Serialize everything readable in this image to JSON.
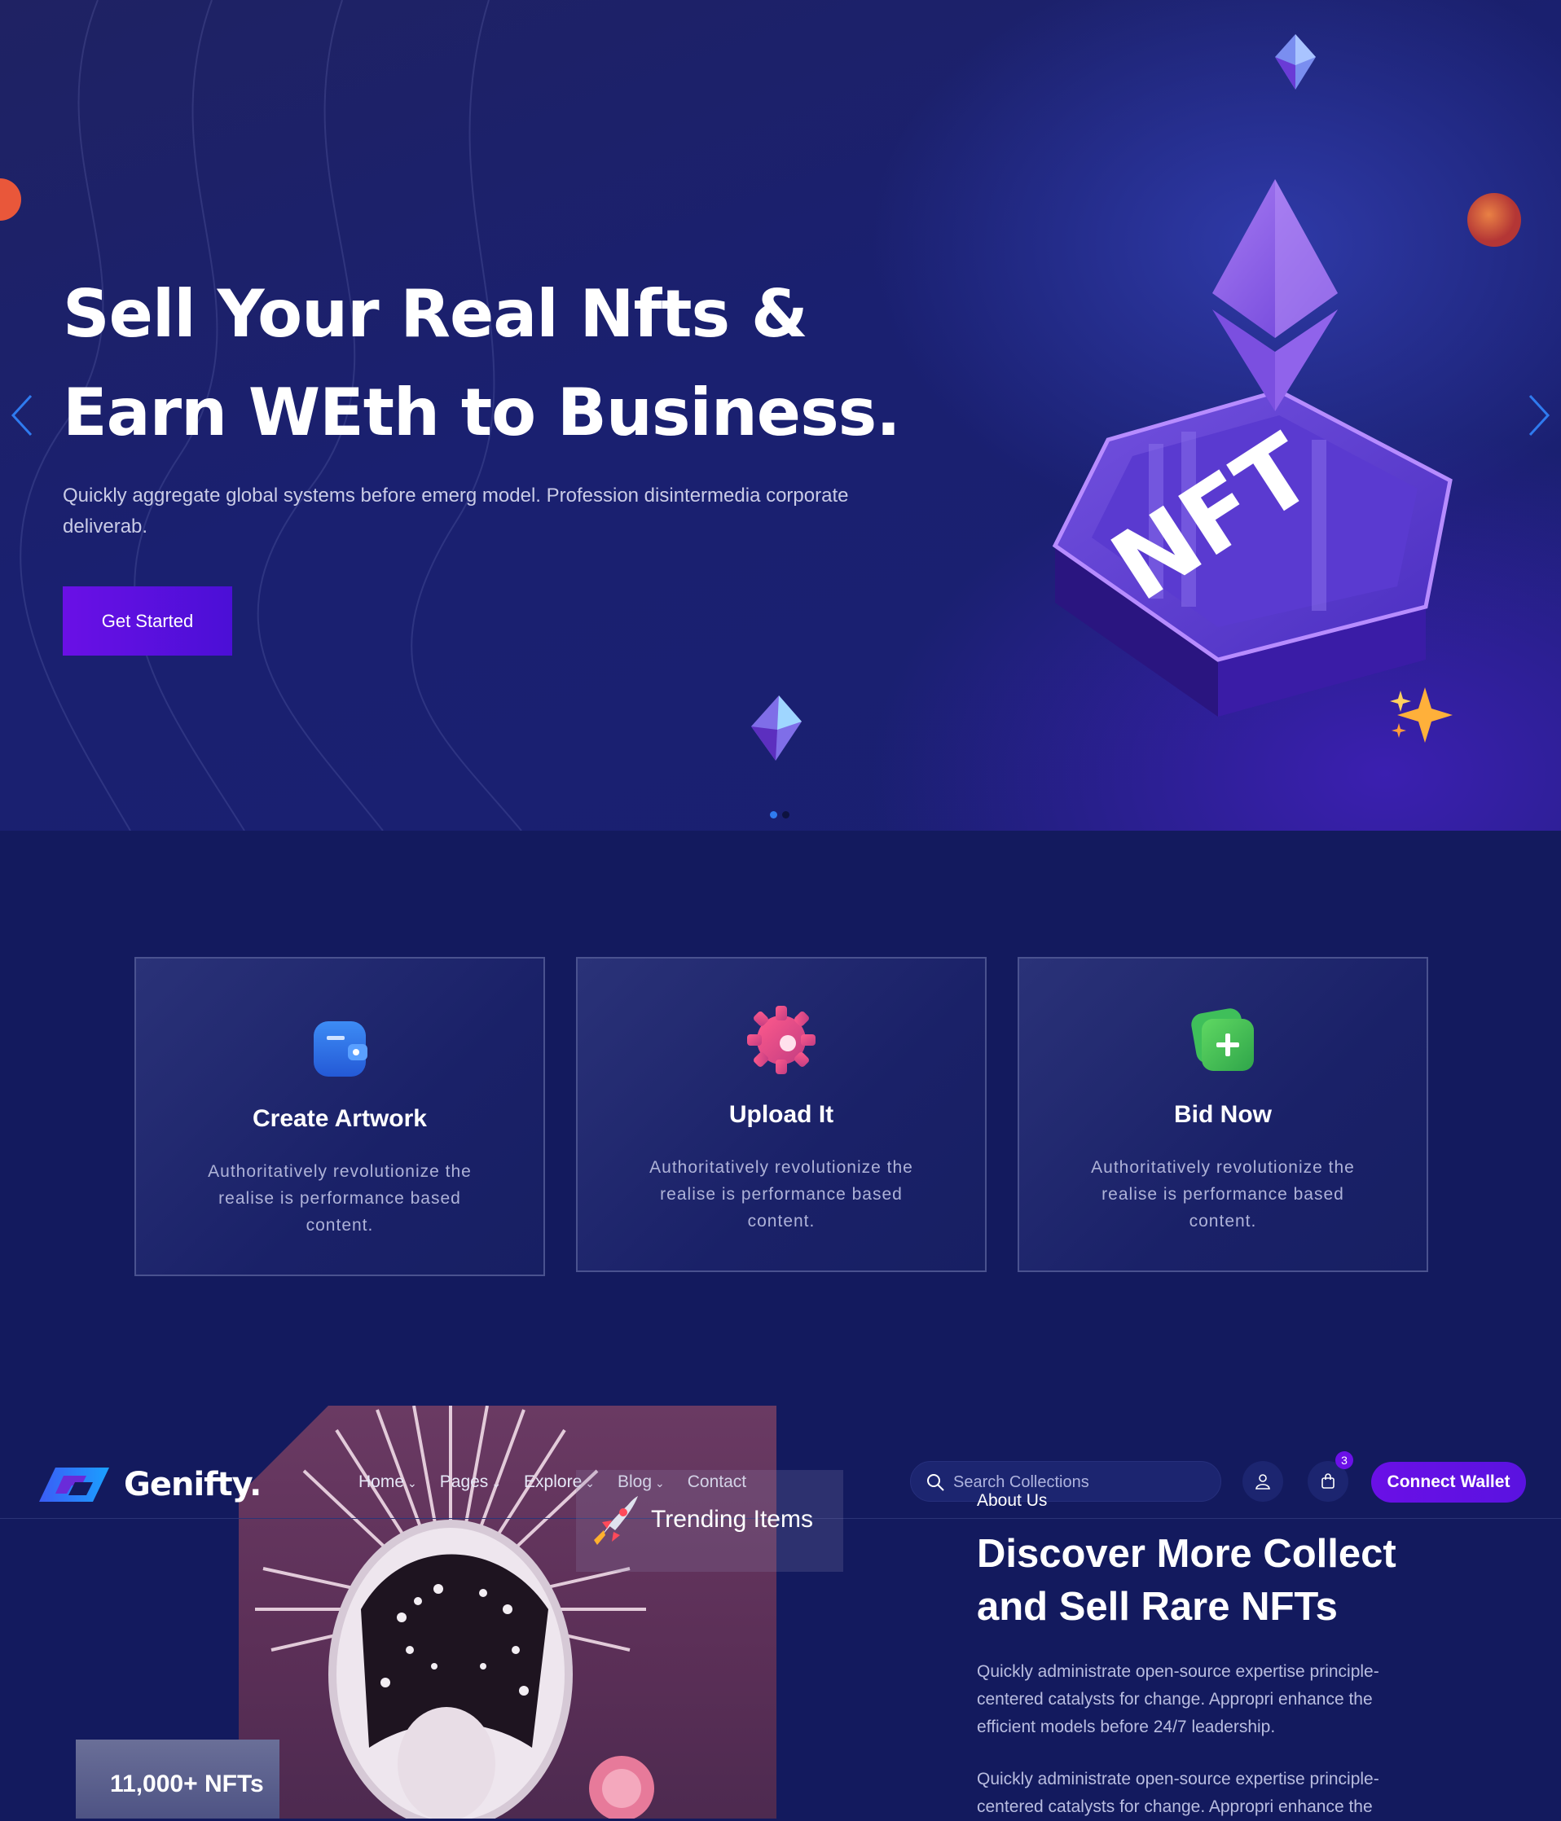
{
  "hero": {
    "title_line1": "Sell Your Real Nfts &",
    "title_line2": "Earn WEth to Business.",
    "subtitle": "Quickly aggregate global systems before emerg model. Profession disintermedia corporate deliverab.",
    "cta_label": "Get Started",
    "art_label": "NFT",
    "slides_total": 2,
    "active_slide": 1
  },
  "features": [
    {
      "icon": "wallet-icon",
      "title": "Create Artwork",
      "text": "Authoritatively revolutionize the realise is performance based content."
    },
    {
      "icon": "gear-icon",
      "title": "Upload It",
      "text": "Authoritatively revolutionize the realise is performance based content."
    },
    {
      "icon": "plus-icon",
      "title": "Bid Now",
      "text": "Authoritatively revolutionize the realise is performance based content."
    }
  ],
  "header": {
    "brand": "Genifty.",
    "menu": [
      {
        "label": "Home",
        "has_dropdown": true
      },
      {
        "label": "Pages",
        "has_dropdown": true
      },
      {
        "label": "Explore",
        "has_dropdown": true
      },
      {
        "label": "Blog",
        "has_dropdown": true
      },
      {
        "label": "Contact",
        "has_dropdown": false
      }
    ],
    "search_placeholder": "Search Collections",
    "cart_count": "3",
    "connect_label": "Connect Wallet"
  },
  "trending": {
    "label": "Trending Items"
  },
  "stats": {
    "nfts": "11,000+ NFTs"
  },
  "about": {
    "label": "About Us",
    "title_line1": "Discover More Collect",
    "title_line2": "and Sell Rare NFTs",
    "paragraph1": "Quickly administrate open-source expertise principle-centered catalysts for change. Appropri enhance the efficient models before 24/7 leadership.",
    "paragraph2": "Quickly administrate open-source expertise principle-centered catalysts for change. Appropri enhance the"
  },
  "colors": {
    "background": "#131a5e",
    "accent": "#6a10e6",
    "card_border": "#4a528f",
    "arrow": "#2f7bf0",
    "dot_active": "#2f7bf0"
  }
}
